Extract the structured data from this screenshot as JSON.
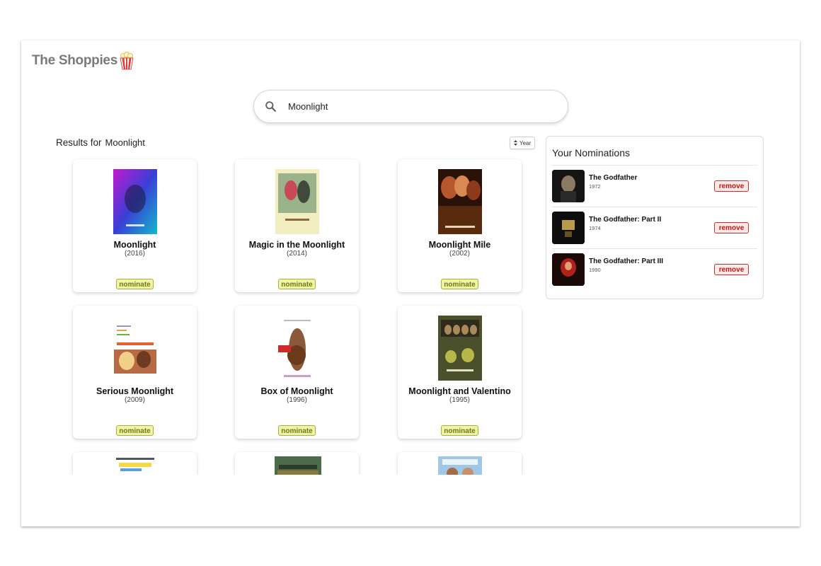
{
  "app": {
    "title": "The Shoppies"
  },
  "search": {
    "value": "Moonlight",
    "icon": "search-icon"
  },
  "results": {
    "label": "Results for",
    "term": "Moonlight",
    "sort_label": "Year",
    "movies": [
      {
        "title": "Moonlight",
        "year": "(2016)",
        "action": "nominate"
      },
      {
        "title": "Magic in the Moonlight",
        "year": "(2014)",
        "action": "nominate"
      },
      {
        "title": "Moonlight Mile",
        "year": "(2002)",
        "action": "nominate"
      },
      {
        "title": "Serious Moonlight",
        "year": "(2009)",
        "action": "nominate"
      },
      {
        "title": "Box of Moonlight",
        "year": "(1996)",
        "action": "nominate"
      },
      {
        "title": "Moonlight and Valentino",
        "year": "(1995)",
        "action": "nominate"
      },
      {
        "title": "",
        "year": "",
        "action": ""
      },
      {
        "title": "",
        "year": "",
        "action": ""
      },
      {
        "title": "",
        "year": "",
        "action": ""
      }
    ]
  },
  "nominations": {
    "title": "Your Nominations",
    "items": [
      {
        "title": "The Godfather",
        "year": "1972",
        "action": "remove"
      },
      {
        "title": "The Godfather: Part II",
        "year": "1974",
        "action": "remove"
      },
      {
        "title": "The Godfather: Part III",
        "year": "1990",
        "action": "remove"
      }
    ]
  },
  "colors": {
    "nominate_bg": "#f0f3a8",
    "nominate_border": "#a8b232",
    "remove_bg": "#fde8e8",
    "remove_border": "#d22c2c",
    "brand_text": "#7a7a7a"
  }
}
